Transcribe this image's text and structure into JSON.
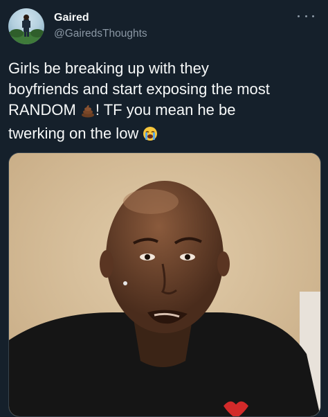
{
  "author": {
    "display_name": "Gaired",
    "handle": "@GairedsThoughts",
    "avatar_icon": "profile-photo"
  },
  "tweet": {
    "line1": "Girls be breaking up with they",
    "line2": "boyfriends and start exposing the most",
    "line3_a": "RANDOM ",
    "line3_b": "! TF you mean he be",
    "line4": "twerking on the low ",
    "emoji_1": "pile-of-poo-emoji",
    "emoji_2": "loudly-crying-face-emoji"
  },
  "media": {
    "description_icon": "meme-photo"
  },
  "colors": {
    "background": "#15202b",
    "text": "#f7f9f9",
    "secondary_text": "#8b98a5"
  }
}
